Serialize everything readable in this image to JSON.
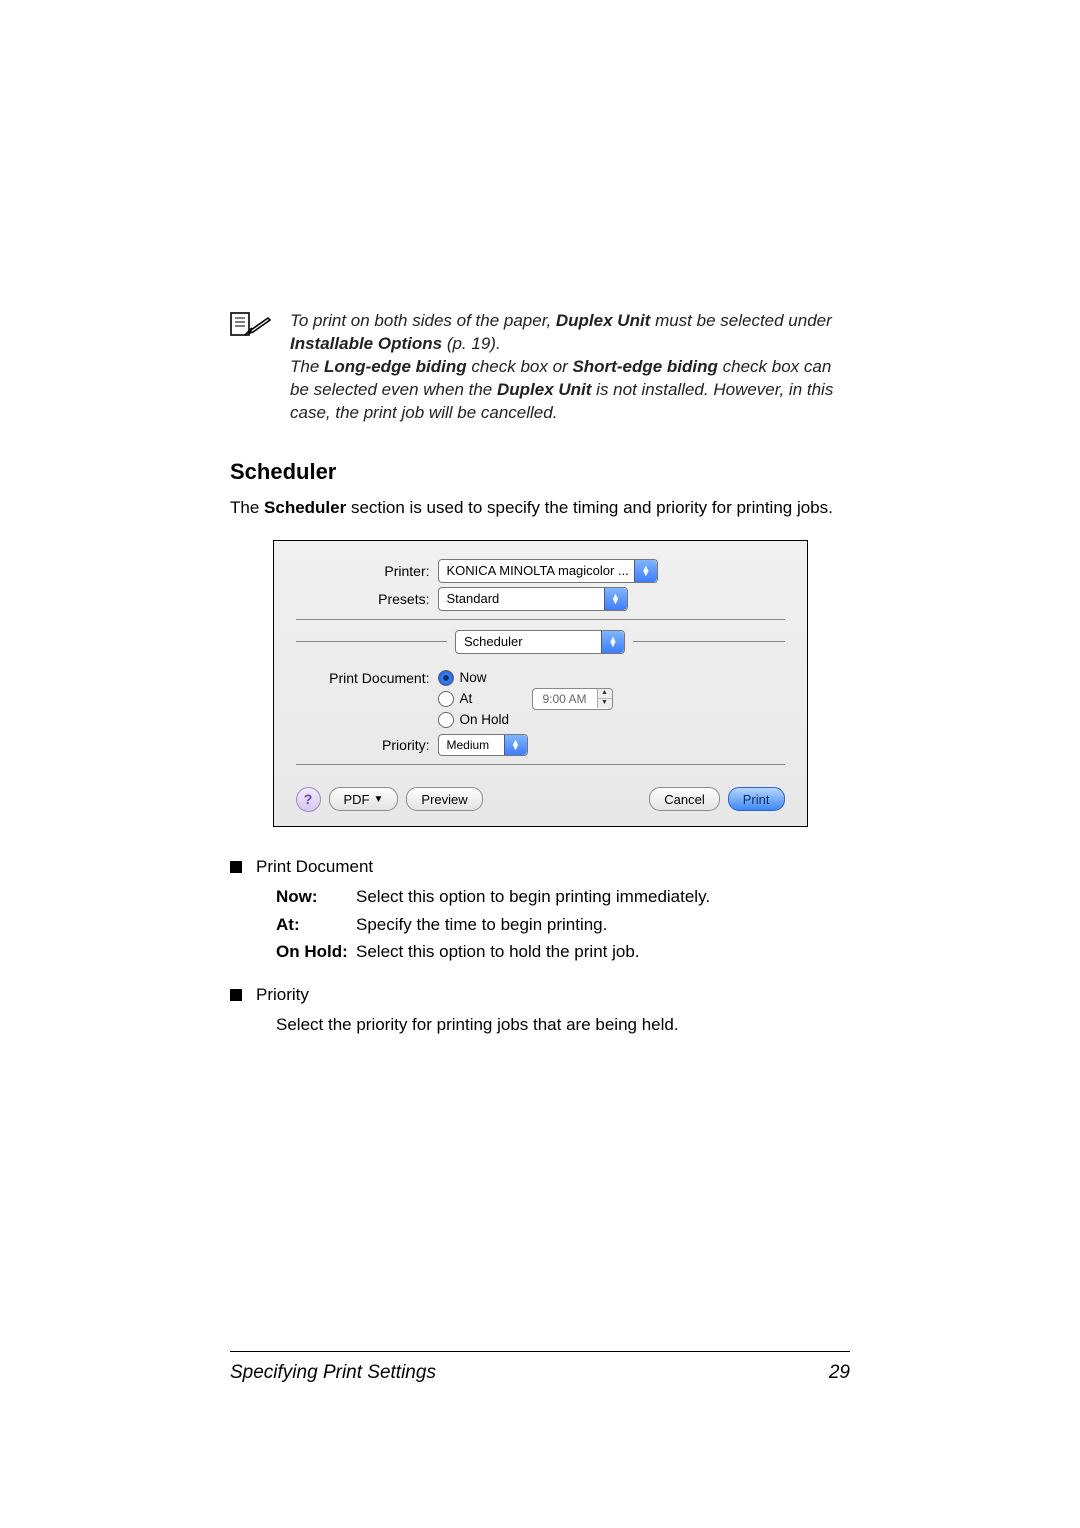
{
  "note": {
    "part1": "To print on both sides of the paper, ",
    "bold1": "Duplex Unit",
    "part2": " must be selected under ",
    "bold2": "Installable Options",
    "part3": " (p. 19).",
    "line2a": "The ",
    "line2b": "Long-edge biding",
    "line2c": " check box or ",
    "line2d": "Short-edge biding",
    "line2e": " check box can be selected even when the ",
    "line2f": "Duplex Unit",
    "line2g": " is not installed. However, in this case, the print job will be cancelled."
  },
  "heading": "Scheduler",
  "intro_a": "The ",
  "intro_bold": "Scheduler",
  "intro_b": " section is used to specify the timing and priority for printing jobs.",
  "dialog": {
    "printer_label": "Printer:",
    "printer_value": "KONICA MINOLTA magicolor ...",
    "presets_label": "Presets:",
    "presets_value": "Standard",
    "section_value": "Scheduler",
    "print_doc_label": "Print Document:",
    "opt_now": "Now",
    "opt_at": "At",
    "at_time": "9:00 AM",
    "opt_hold": "On Hold",
    "priority_label": "Priority:",
    "priority_value": "Medium",
    "help": "?",
    "pdf_btn": "PDF",
    "preview_btn": "Preview",
    "cancel_btn": "Cancel",
    "print_btn": "Print"
  },
  "bullets": {
    "print_document": "Print Document",
    "now_key": "Now",
    "now_val": "Select this option to begin printing immediately.",
    "at_key": "At",
    "at_val": "Specify the time to begin printing.",
    "hold_key": "On Hold",
    "hold_val": "Select this option to hold the print job.",
    "priority": "Priority",
    "priority_text": "Select the priority for printing jobs that are being held."
  },
  "footer": {
    "left": "Specifying Print Settings",
    "right": "29"
  }
}
